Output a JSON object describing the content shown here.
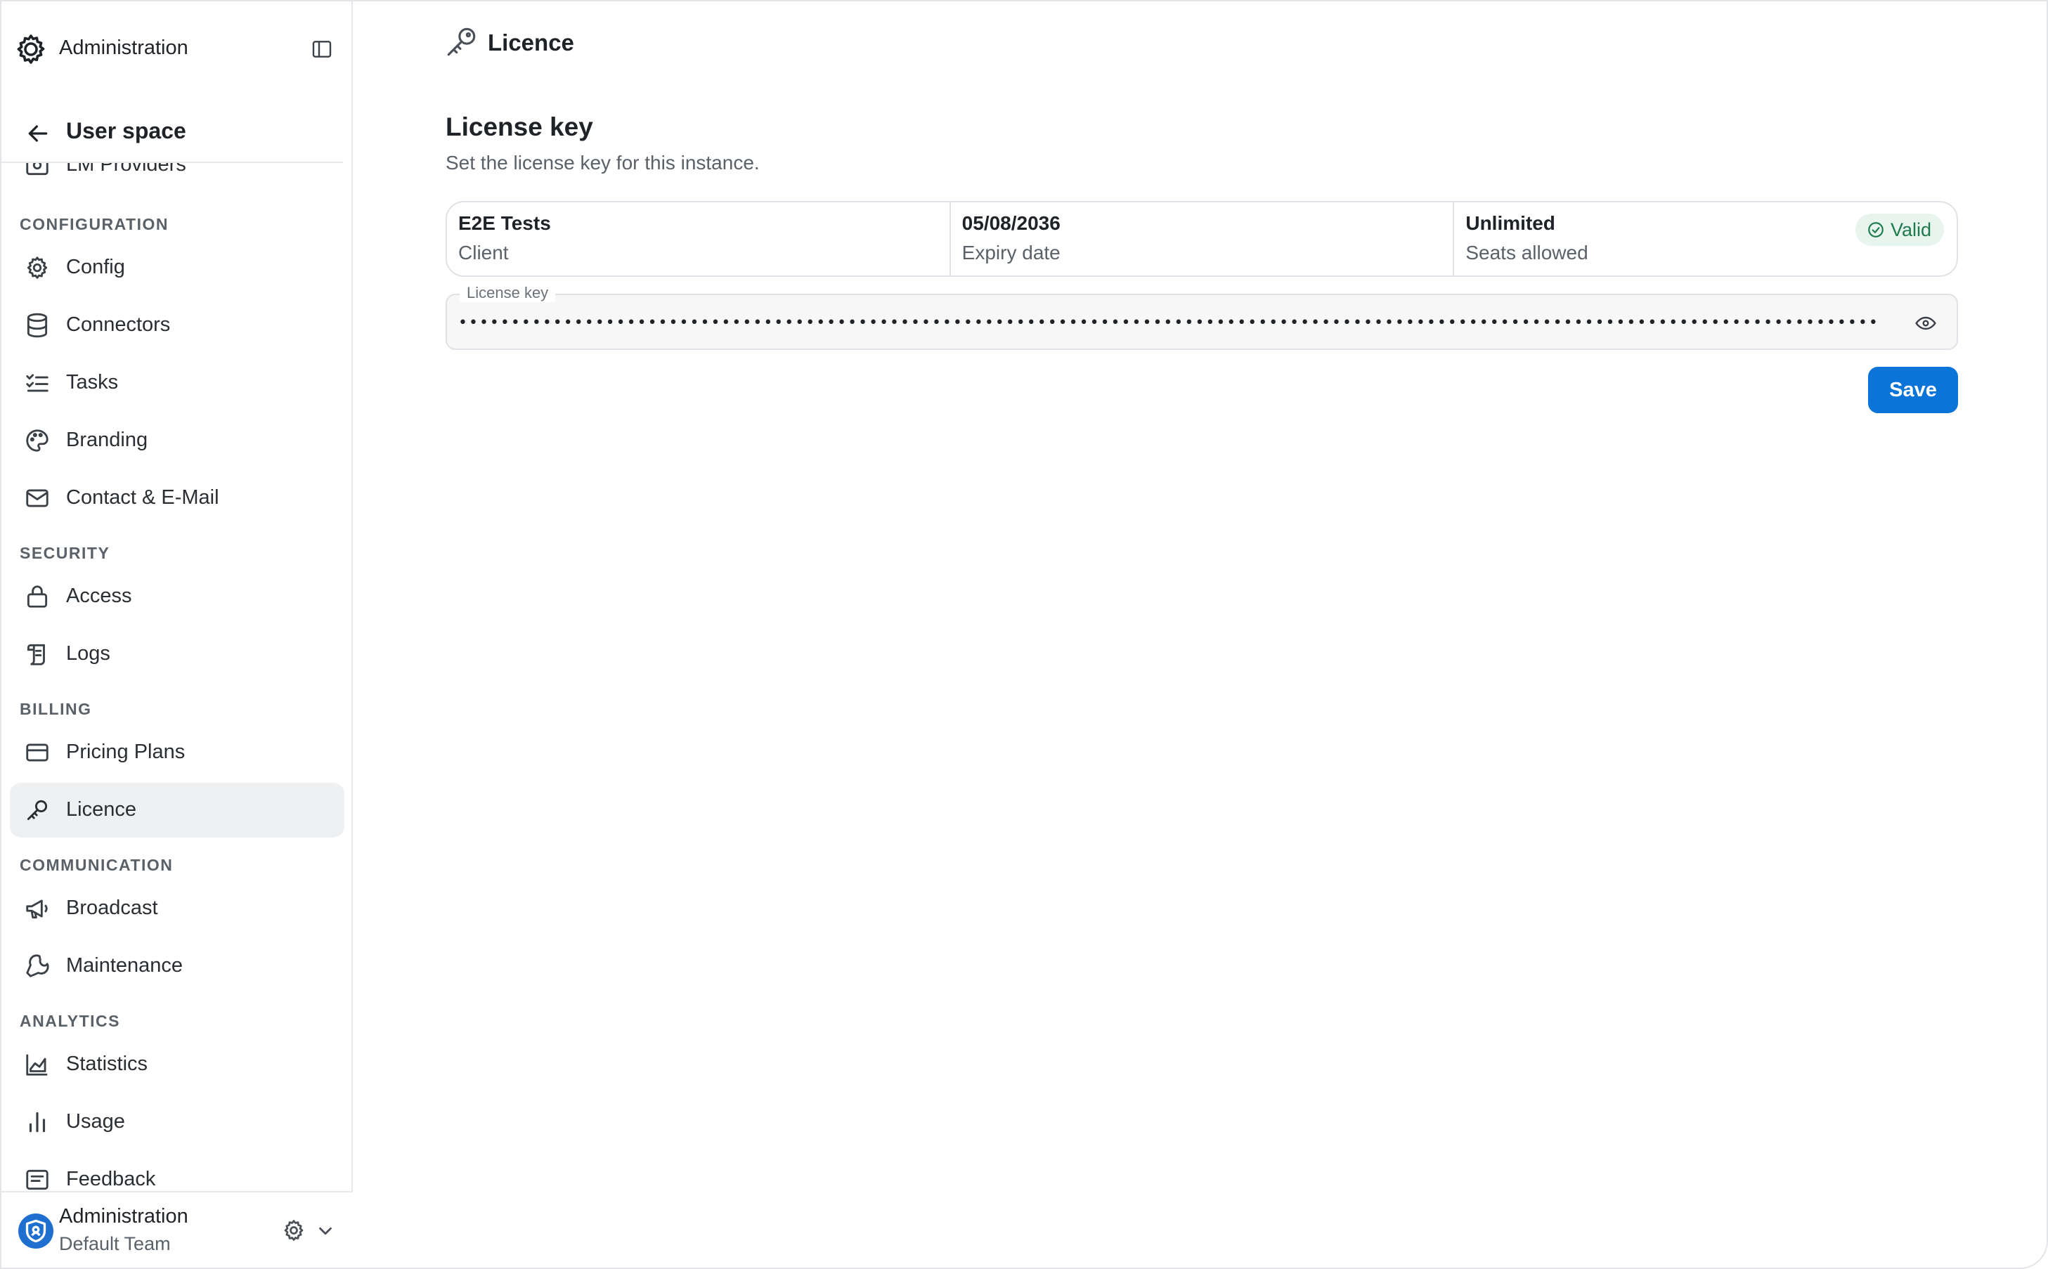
{
  "sidebar": {
    "title": "Administration",
    "back_label": "User space",
    "partial_item": "LM Providers",
    "sections": {
      "configuration": "CONFIGURATION",
      "security": "SECURITY",
      "billing": "BILLING",
      "communication": "COMMUNICATION",
      "analytics": "ANALYTICS"
    },
    "items": {
      "config": "Config",
      "connectors": "Connectors",
      "tasks": "Tasks",
      "branding": "Branding",
      "contact": "Contact & E-Mail",
      "access": "Access",
      "logs": "Logs",
      "pricing": "Pricing Plans",
      "licence": "Licence",
      "broadcast": "Broadcast",
      "maintenance": "Maintenance",
      "statistics": "Statistics",
      "usage": "Usage",
      "feedback": "Feedback"
    },
    "active_item": "licence",
    "footer": {
      "name": "Administration",
      "team": "Default Team"
    }
  },
  "main": {
    "page_title": "Licence",
    "section_title": "License key",
    "section_description": "Set the license key for this instance.",
    "info": [
      {
        "value": "E2E Tests",
        "label": "Client"
      },
      {
        "value": "05/08/2036",
        "label": "Expiry date"
      },
      {
        "value": "Unlimited",
        "label": "Seats allowed"
      }
    ],
    "status_badge": "Valid",
    "license_field": {
      "label": "License key",
      "value": "••••••••••••••••••••••••••••••••••••••••••••••••••••••••••••••••••••••••••••••••••••••••••••••••••••••••••••••••••••••••••••••••••••••••••••••"
    },
    "save_label": "Save"
  },
  "colors": {
    "accent": "#0b74d8",
    "valid_bg": "#e8f4ee",
    "valid_text": "#1e7b4b",
    "active_nav_bg": "#eff0f2"
  }
}
